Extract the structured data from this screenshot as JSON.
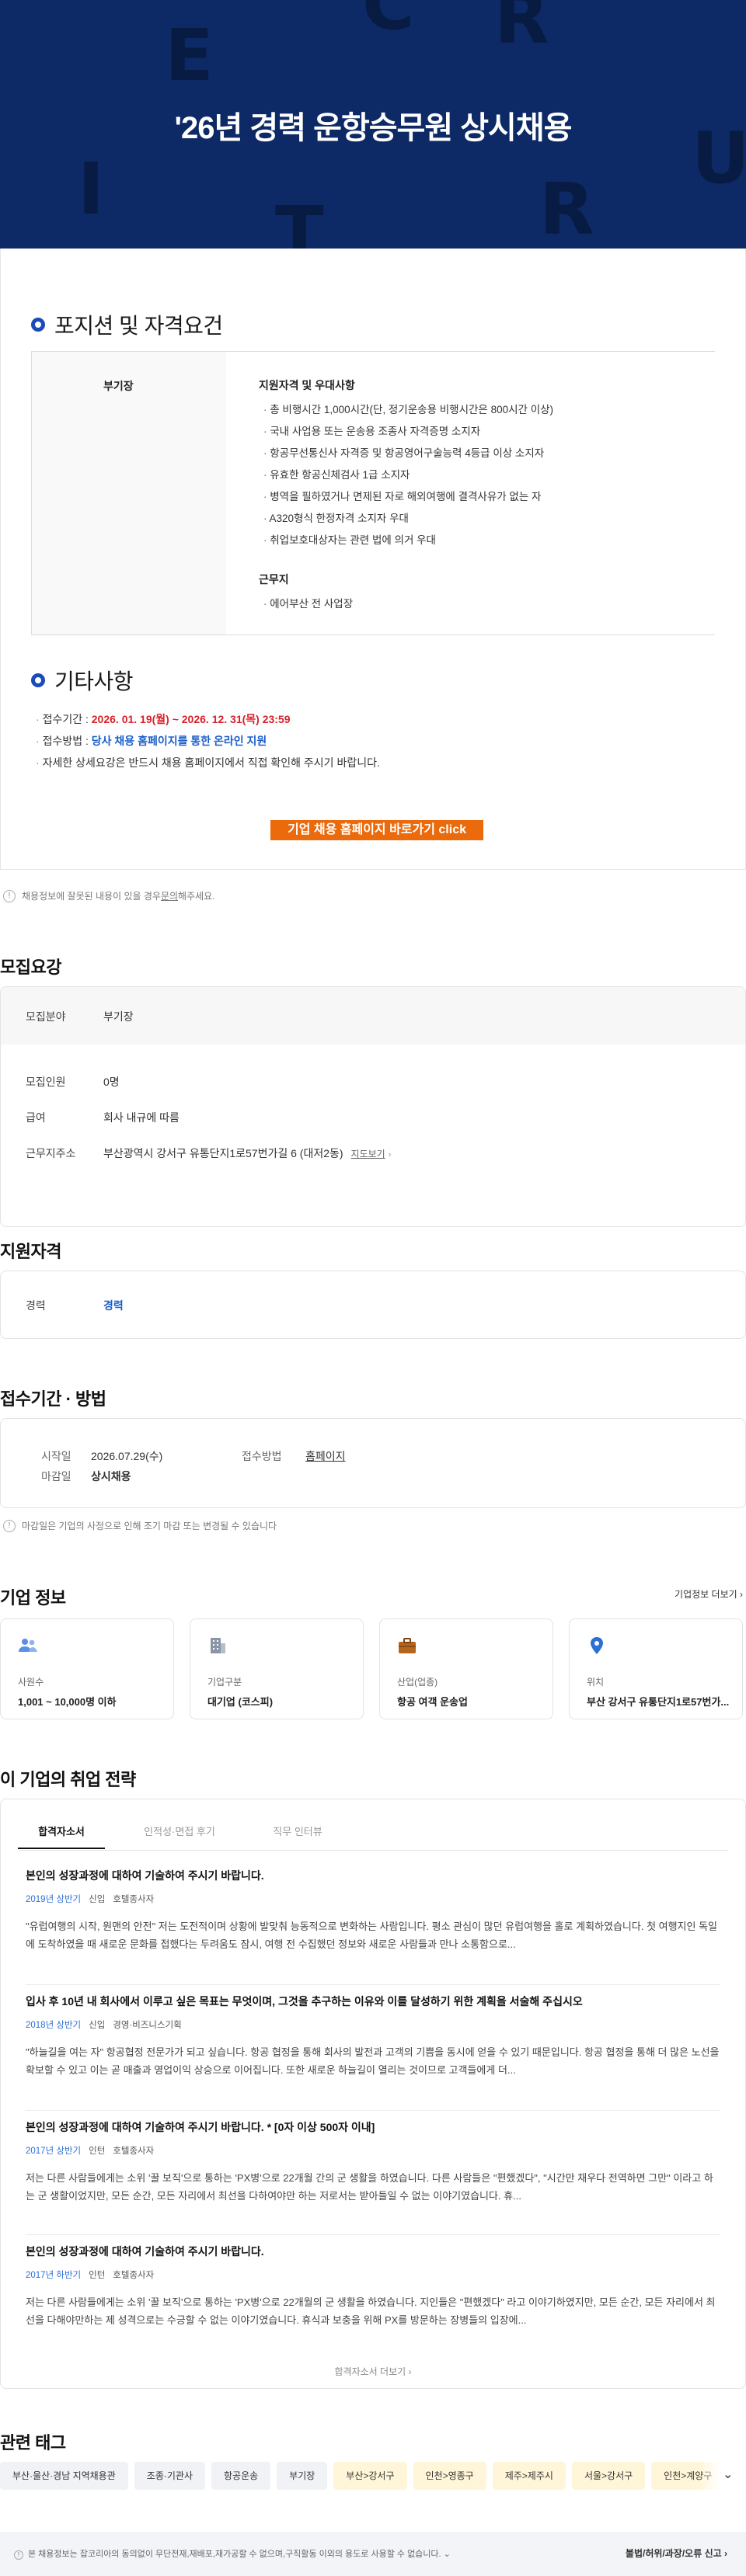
{
  "banner": {
    "title": "'26년 경력 운항승무원 상시채용",
    "bg_letters": [
      "E",
      "C",
      "R",
      "U",
      "I",
      "T",
      "R"
    ]
  },
  "position": {
    "heading": "포지션 및 자격요건",
    "role": "부기장",
    "qual_heading": "지원자격 및 우대사항",
    "qualifications": [
      "총 비행시간 1,000시간(단, 정기운송용 비행시간은 800시간 이상)",
      "국내 사업용 또는 운송용 조종사 자격증명 소지자",
      "항공무선통신사 자격증 및 항공영어구술능력 4등급 이상 소지자",
      "유효한 항공신체검사 1급 소지자",
      "병역을 필하였거나 면제된 자로 해외여행에 결격사유가 없는 자",
      "A320형식 한정자격 소지자 우대",
      "취업보호대상자는 관련 법에 의거 우대"
    ],
    "location_heading": "근무지",
    "locations": [
      "에어부산 전 사업장"
    ]
  },
  "etc": {
    "heading": "기타사항",
    "period_label": "접수기간 : ",
    "period_value": "2026. 01. 19(월) ~ 2026. 12. 31(목) 23:59",
    "method_label": "접수방법 : ",
    "method_value": "당사 채용 홈페이지를 통한 온라인 지원",
    "detail": "자세한 상세요강은 반드시 채용 홈페이지에서 직접 확인해 주시기 바랍니다."
  },
  "cta_label": "기업 채용 홈페이지 바로가기 click",
  "report_notice": {
    "prefix": "채용정보에 잘못된 내용이 있을 경우 ",
    "link": "문의",
    "suffix": "해주세요."
  },
  "recruit": {
    "heading": "모집요강",
    "field_label": "모집분야",
    "field_value": "부기장",
    "count_label": "모집인원",
    "count_value": "0명",
    "salary_label": "급여",
    "salary_value": "회사 내규에 따름",
    "address_label": "근무지주소",
    "address_value": "부산광역시 강서구 유통단지1로57번가길 6 (대저2동)",
    "map_link": "지도보기"
  },
  "eligibility": {
    "heading": "지원자격",
    "career_label": "경력",
    "career_value": "경력"
  },
  "apply": {
    "heading": "접수기간 · 방법",
    "start_label": "시작일",
    "start_value": "2026.07.29(수)",
    "end_label": "마감일",
    "end_value": "상시채용",
    "method_label": "접수방법",
    "method_value": "홈페이지",
    "notice": "마감일은 기업의 사정으로 인해 조기 마감 또는 변경될 수 있습니다"
  },
  "company": {
    "heading": "기업 정보",
    "more_link": "기업정보 더보기",
    "cards": [
      {
        "label": "사원수",
        "value": "1,001 ~ 10,000명 이하",
        "icon": "people-icon"
      },
      {
        "label": "기업구분",
        "value": "대기업 (코스피)",
        "icon": "building-icon"
      },
      {
        "label": "산업(업종)",
        "value": "항공 여객 운송업",
        "icon": "briefcase-icon"
      },
      {
        "label": "위치",
        "value": "부산 강서구 유통단지1로57번가...",
        "icon": "location-pin-icon"
      }
    ]
  },
  "strategy": {
    "heading": "이 기업의 취업 전략",
    "tabs": [
      "합격자소서",
      "인적성·면접 후기",
      "직무 인터뷰"
    ],
    "essays": [
      {
        "question": "본인의 성장과정에 대하여 기술하여 주시기 바랍니다.",
        "year": "2019년 상반기",
        "type": "신입",
        "job": "호텔종사자",
        "answer": "\"유럽여행의 시작, 원맨의 안전\" 저는 도전적이며 상황에 발맞춰 능동적으로 변화하는 사람입니다. 평소 관심이 많던 유럽여행을 홀로 계획하였습니다. 첫 여행지인 독일에 도착하였을 때 새로운 문화를 접했다는 두려움도 잠시, 여행 전 수집했던 정보와 새로운 사람들과 만나 소통함으로..."
      },
      {
        "question": "입사 후 10년 내 회사에서 이루고 싶은 목표는 무엇이며, 그것을 추구하는 이유와 이를 달성하기 위한 계획을 서술해 주십시오",
        "year": "2018년 상반기",
        "type": "신입",
        "job": "경영·비즈니스기획",
        "answer": "\"하늘길을 여는 자\" 항공협정 전문가가 되고 싶습니다. 항공 협정을 통해 회사의 발전과 고객의 기쁨을 동시에 얻을 수 있기 때문입니다. 항공 협정을 통해 더 많은 노선을 확보할 수 있고 이는 곧 매출과 영업이익 상승으로 이어집니다. 또한 새로운 하늘길이 열리는 것이므로 고객들에게 더..."
      },
      {
        "question": "본인의 성장과정에 대하여 기술하여 주시기 바랍니다. * [0자 이상 500자 이내]",
        "year": "2017년 상반기",
        "type": "인턴",
        "job": "호텔종사자",
        "answer": "저는 다른 사람들에게는 소위 '꿀 보직'으로 통하는 'PX병'으로 22개월 간의 군 생활을 하였습니다. 다른 사람들은 \"편했겠다\", \"시간만 채우다 전역하면 그만\" 이라고 하는 군 생활이었지만, 모든 순간, 모든 자리에서 최선을 다하여야만 하는 저로서는 받아들일 수 없는 이야기였습니다. 휴..."
      },
      {
        "question": "본인의 성장과정에 대하여 기술하여 주시기 바랍니다.",
        "year": "2017년 하반기",
        "type": "인턴",
        "job": "호텔종사자",
        "answer": "저는 다른 사람들에게는 소위 '꿀 보직'으로 통하는 'PX병'으로 22개월의 군 생활을 하였습니다. 지인들은 \"편했겠다\" 라고 이야기하였지만, 모든 순간, 모든 자리에서 최선을 다해야만하는 제 성격으로는 수긍할 수 없는 이야기였습니다. 휴식과 보충을 위해 PX를 방문하는 장병들의 입장에..."
      }
    ],
    "more_link": "합격자소서 더보기"
  },
  "tags": {
    "heading": "관련 태그",
    "items": [
      "부산·울산·경남 지역채용관",
      "조종·기관사",
      "항공운송",
      "부기장",
      "부산>강서구",
      "인천>영종구",
      "제주>제주시",
      "서울>강서구",
      "인천>계양구"
    ]
  },
  "footer": {
    "notice": "본 채용정보는 잡코리아의 동의없이 무단전재,재배포,재가공할 수 없으며,구직활동 이외의 용도로 사용할 수 없습니다.",
    "report": "불법/허위/과장/오류 신고"
  },
  "colors": {
    "banner": "#0d2a66",
    "accent_blue": "#1b4bb8",
    "cta_orange": "#ea6a0c",
    "red": "#d8222a"
  }
}
